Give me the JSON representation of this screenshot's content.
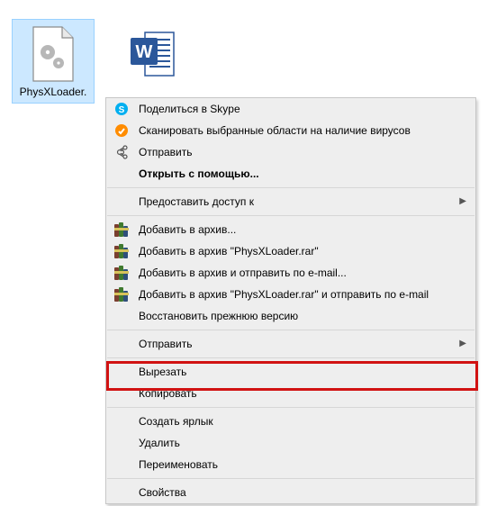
{
  "files": {
    "physx": {
      "label": "PhysXLoader."
    },
    "word": {
      "label": ""
    }
  },
  "menu": {
    "skype": "Поделиться в Skype",
    "scan": "Сканировать выбранные области на наличие вирусов",
    "send": "Отправить",
    "openwith": "Открыть с помощью...",
    "shareaccess": "Предоставить доступ к",
    "rar_add": "Добавить в архив...",
    "rar_add_named": "Добавить в архив \"PhysXLoader.rar\"",
    "rar_email": "Добавить в архив и отправить по e-mail...",
    "rar_email_named": "Добавить в архив \"PhysXLoader.rar\" и отправить по e-mail",
    "restore": "Восстановить прежнюю версию",
    "sendto": "Отправить",
    "cut": "Вырезать",
    "copy": "Копировать",
    "shortcut": "Создать ярлык",
    "delete": "Удалить",
    "rename": "Переименовать",
    "props": "Свойства"
  }
}
